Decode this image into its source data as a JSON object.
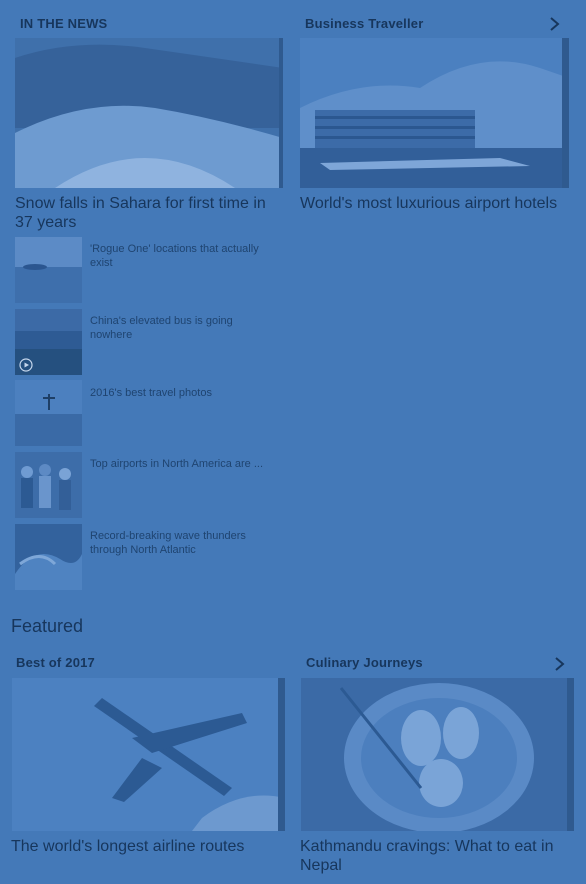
{
  "in_the_news": {
    "label": "IN THE NEWS",
    "main_headline": "Snow falls in Sahara for first time in 37 years",
    "items": [
      {
        "title": "'Rogue One' locations that actually exist",
        "has_video": false
      },
      {
        "title": "China's elevated bus is going nowhere",
        "has_video": true
      },
      {
        "title": "2016's best travel photos",
        "has_video": false
      },
      {
        "title": "Top airports in North America are ...",
        "has_video": false
      },
      {
        "title": "Record-breaking wave thunders through North Atlantic",
        "has_video": false
      }
    ]
  },
  "business_traveller": {
    "label": "Business Traveller",
    "headline": "World's most luxurious airport hotels"
  },
  "featured": {
    "title": "Featured",
    "cards": [
      {
        "label": "Best of 2017",
        "headline": "The world's longest airline routes"
      },
      {
        "label": "Culinary Journeys",
        "headline": "Kathmandu cravings: What to eat in Nepal"
      }
    ]
  },
  "icons": {
    "chevron": "chevron-right-icon",
    "play": "play-icon"
  },
  "colors": {
    "background": "#4479b8",
    "text": "#17365c"
  }
}
